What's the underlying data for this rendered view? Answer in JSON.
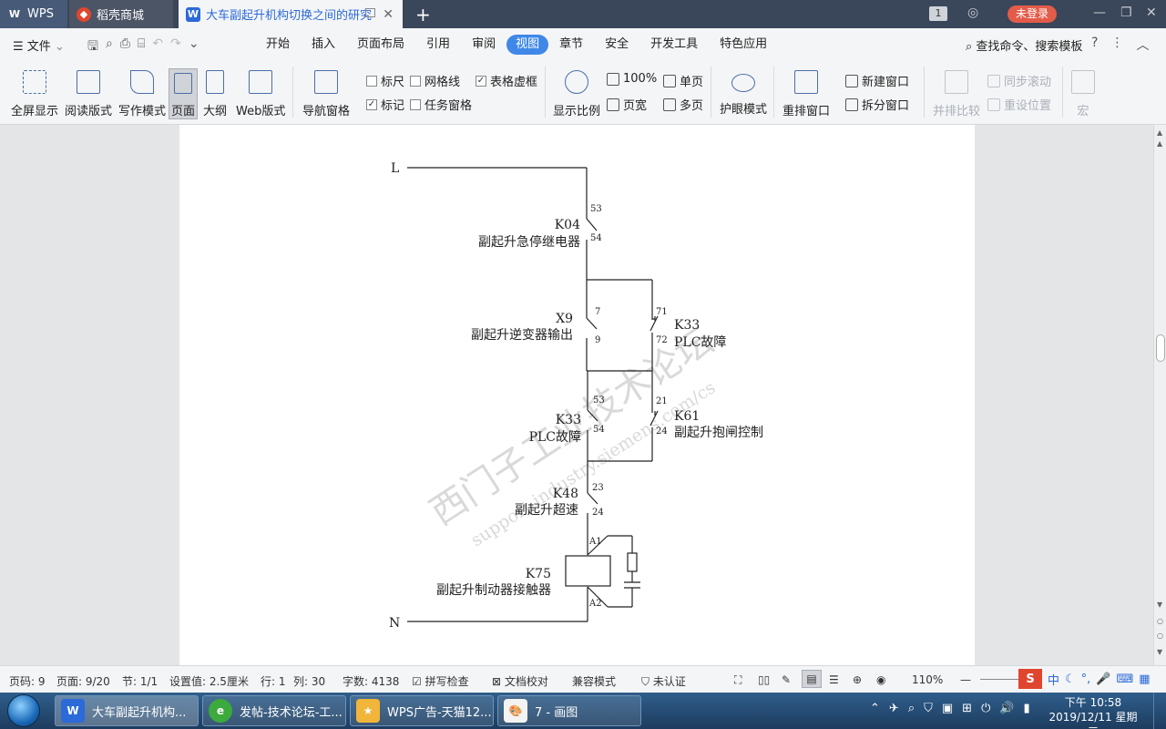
{
  "tabs": {
    "wps": "WPS",
    "store": "稻壳商城",
    "doc": "大车副起升机构切换之间的研究",
    "new_tab": "+"
  },
  "titlebar": {
    "count": "1",
    "login": "未登录"
  },
  "menu": {
    "file": "文件",
    "items": [
      "开始",
      "插入",
      "页面布局",
      "引用",
      "审阅",
      "视图",
      "章节",
      "安全",
      "开发工具",
      "特色应用"
    ],
    "active": "视图",
    "search": "查找命令、搜索模板"
  },
  "ribbon": {
    "fullscreen": "全屏显示",
    "read_mode": "阅读版式",
    "write_mode": "写作模式",
    "page": "页面",
    "outline": "大纲",
    "web": "Web版式",
    "nav_pane": "导航窗格",
    "ruler": "标尺",
    "gridline": "网格线",
    "table_grid": "表格虚框",
    "mark": "标记",
    "task_pane": "任务窗格",
    "zoom_ratio": "显示比例",
    "zoom100": "100%",
    "page_width": "页宽",
    "single_page": "单页",
    "multi_page": "多页",
    "eye_care": "护眼模式",
    "arrange": "重排窗口",
    "new_window": "新建窗口",
    "split_window": "拆分窗口",
    "side_by_side": "并排比较",
    "sync_scroll": "同步滚动",
    "reset_pos": "重设位置",
    "macro": "宏"
  },
  "diagram": {
    "L": "L",
    "N": "N",
    "k04_id": "K04",
    "k04_desc": "副起升急停继电器",
    "k04_t1": "53",
    "k04_t2": "54",
    "x9_id": "X9",
    "x9_desc": "副起升逆变器输出",
    "x9_t1": "7",
    "x9_t2": "9",
    "k33a_id": "K33",
    "k33a_desc": "PLC故障",
    "k33a_t1": "71",
    "k33a_t2": "72",
    "k33b_id": "K33",
    "k33b_desc": "PLC故障",
    "k33b_t1": "53",
    "k33b_t2": "54",
    "k61_id": "K61",
    "k61_desc": "副起升抱闸控制",
    "k61_t1": "21",
    "k61_t2": "24",
    "k48_id": "K48",
    "k48_desc": "副起升超速",
    "k48_t1": "23",
    "k48_t2": "24",
    "k75_id": "K75",
    "k75_desc": "副起升制动器接触器",
    "k75_t1": "A1",
    "k75_t2": "A2",
    "watermark1": "西门子工业技术论坛",
    "watermark2": "support.industry.siemens.com/cs"
  },
  "status": {
    "page_code": "页码: 9",
    "page_num": "页面: 9/20",
    "section": "节: 1/1",
    "setting": "设置值: 2.5厘米",
    "row": "行: 1",
    "col": "列: 30",
    "word_count": "字数: 4138",
    "spell": "拼写检查",
    "proof": "文档校对",
    "compat": "兼容模式",
    "cert": "未认证",
    "zoom": "110%"
  },
  "taskbar": {
    "task1": "大车副起升机构...",
    "task2": "发帖-技术论坛-工...",
    "task3": "WPS广告-天猫12...",
    "task4": "7 - 画图",
    "time": "下午 10:58",
    "date": "2019/12/11 星期三"
  }
}
